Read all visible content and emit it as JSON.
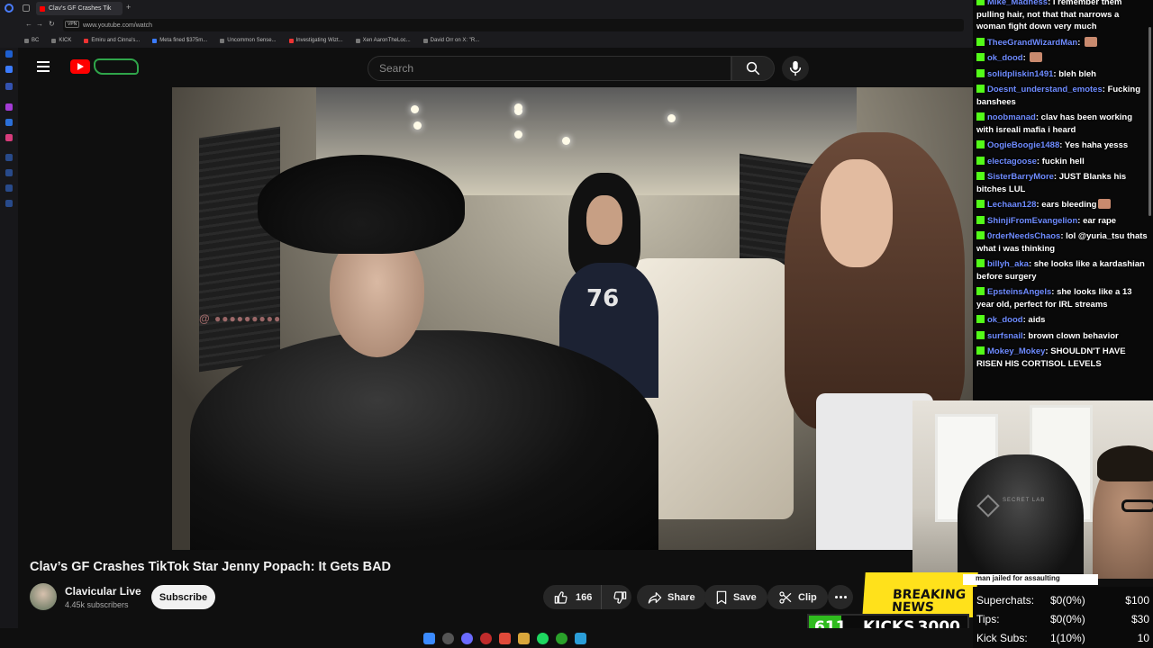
{
  "browser": {
    "active_tab_title": "Clav's GF Crashes Tik",
    "new_tab_symbol": "+",
    "url": "www.youtube.com/watch",
    "vpn_label": "VPN",
    "bookmarks": [
      {
        "label": "BC",
        "icon": "bookmark-icon"
      },
      {
        "label": "KICK",
        "icon": "folder-icon"
      },
      {
        "label": "Emiru and Cinna's...",
        "icon": "youtube-icon"
      },
      {
        "label": "Meta fined $375m...",
        "icon": "youtube-icon"
      },
      {
        "label": "Uncommon Sense...",
        "icon": "x-icon"
      },
      {
        "label": "Investigating Wizt...",
        "icon": "youtube-icon"
      },
      {
        "label": "Xen AaronTheLoc...",
        "icon": "x-icon"
      },
      {
        "label": "David Orr on X: \"R...",
        "icon": "x-icon"
      }
    ]
  },
  "youtube": {
    "search_placeholder": "Search",
    "video_title": "Clav’s GF Crashes TikTok Star Jenny Popach: It Gets BAD",
    "video_jersey_number": "76",
    "channel_name": "Clavicular Live",
    "channel_subs": "4.45k subscribers",
    "subscribe_label": "Subscribe",
    "like_count": "166",
    "share_label": "Share",
    "save_label": "Save",
    "clip_label": "Clip"
  },
  "chat": {
    "messages": [
      {
        "user": "Mike_Madness",
        "text": "I remember them pulling hair, not that that narrows a woman fight down very much",
        "emote": false
      },
      {
        "user": "TheeGrandWizardMan",
        "text": "",
        "emote": true
      },
      {
        "user": "ok_dood",
        "text": "",
        "emote": true
      },
      {
        "user": "solidpliskin1491",
        "text": "bleh bleh",
        "emote": false
      },
      {
        "user": "Doesnt_understand_emotes",
        "text": "Fucking banshees",
        "emote": false
      },
      {
        "user": "noobmanad",
        "text": "clav has been working with isreali mafia i heard",
        "emote": false
      },
      {
        "user": "OogieBoogie1488",
        "text": "Yes haha yesss",
        "emote": false
      },
      {
        "user": "electagoose",
        "text": "fuckin hell",
        "emote": false
      },
      {
        "user": "SisterBarryMore",
        "text": "JUST Blanks his bitches LUL",
        "emote": false
      },
      {
        "user": "Lechaan128",
        "text": "ears bleeding",
        "emote": true
      },
      {
        "user": "ShinjiFromEvangelion",
        "text": "ear rape",
        "emote": false
      },
      {
        "user": "0rderNeedsChaos",
        "text": "lol @yuria_tsu thats what i was thinking",
        "emote": false
      },
      {
        "user": "billyh_aka",
        "text": "she looks like a kardashian before surgery",
        "emote": false
      },
      {
        "user": "EpsteinsAngels",
        "text": "she looks like a 13 year old, perfect for IRL streams",
        "emote": false
      },
      {
        "user": "ok_dood",
        "text": "aids",
        "emote": false
      },
      {
        "user": "surfsnail",
        "text": "brown clown behavior",
        "emote": false
      },
      {
        "user": "Mokey_Mokey",
        "text": "SHOULDN'T HAVE RISEN HIS CORTISOL LEVELS",
        "emote": false
      }
    ]
  },
  "webcam": {
    "chair_brand": "SECRET LAB"
  },
  "overlay": {
    "ticker_text": "man jailed for assaulting",
    "breaking_text": "BREAKING NEWS",
    "stats": [
      {
        "label": "Superchats:",
        "value": "$0(0%)",
        "amount": "$100"
      },
      {
        "label": "Tips:",
        "value": "$0(0%)",
        "amount": "$30"
      },
      {
        "label": "Kick Subs:",
        "value": "1(10%)",
        "amount": "10"
      }
    ],
    "kicks_count": "611",
    "kicks_label": "KICKS",
    "kicks_goal": "3000",
    "kicks_progress": 0.2037
  },
  "colors": {
    "yt_red": "#ff0000",
    "kick_green": "#53fc18",
    "username_blue": "#6e8bff",
    "breaking_yellow": "#ffe11b"
  }
}
